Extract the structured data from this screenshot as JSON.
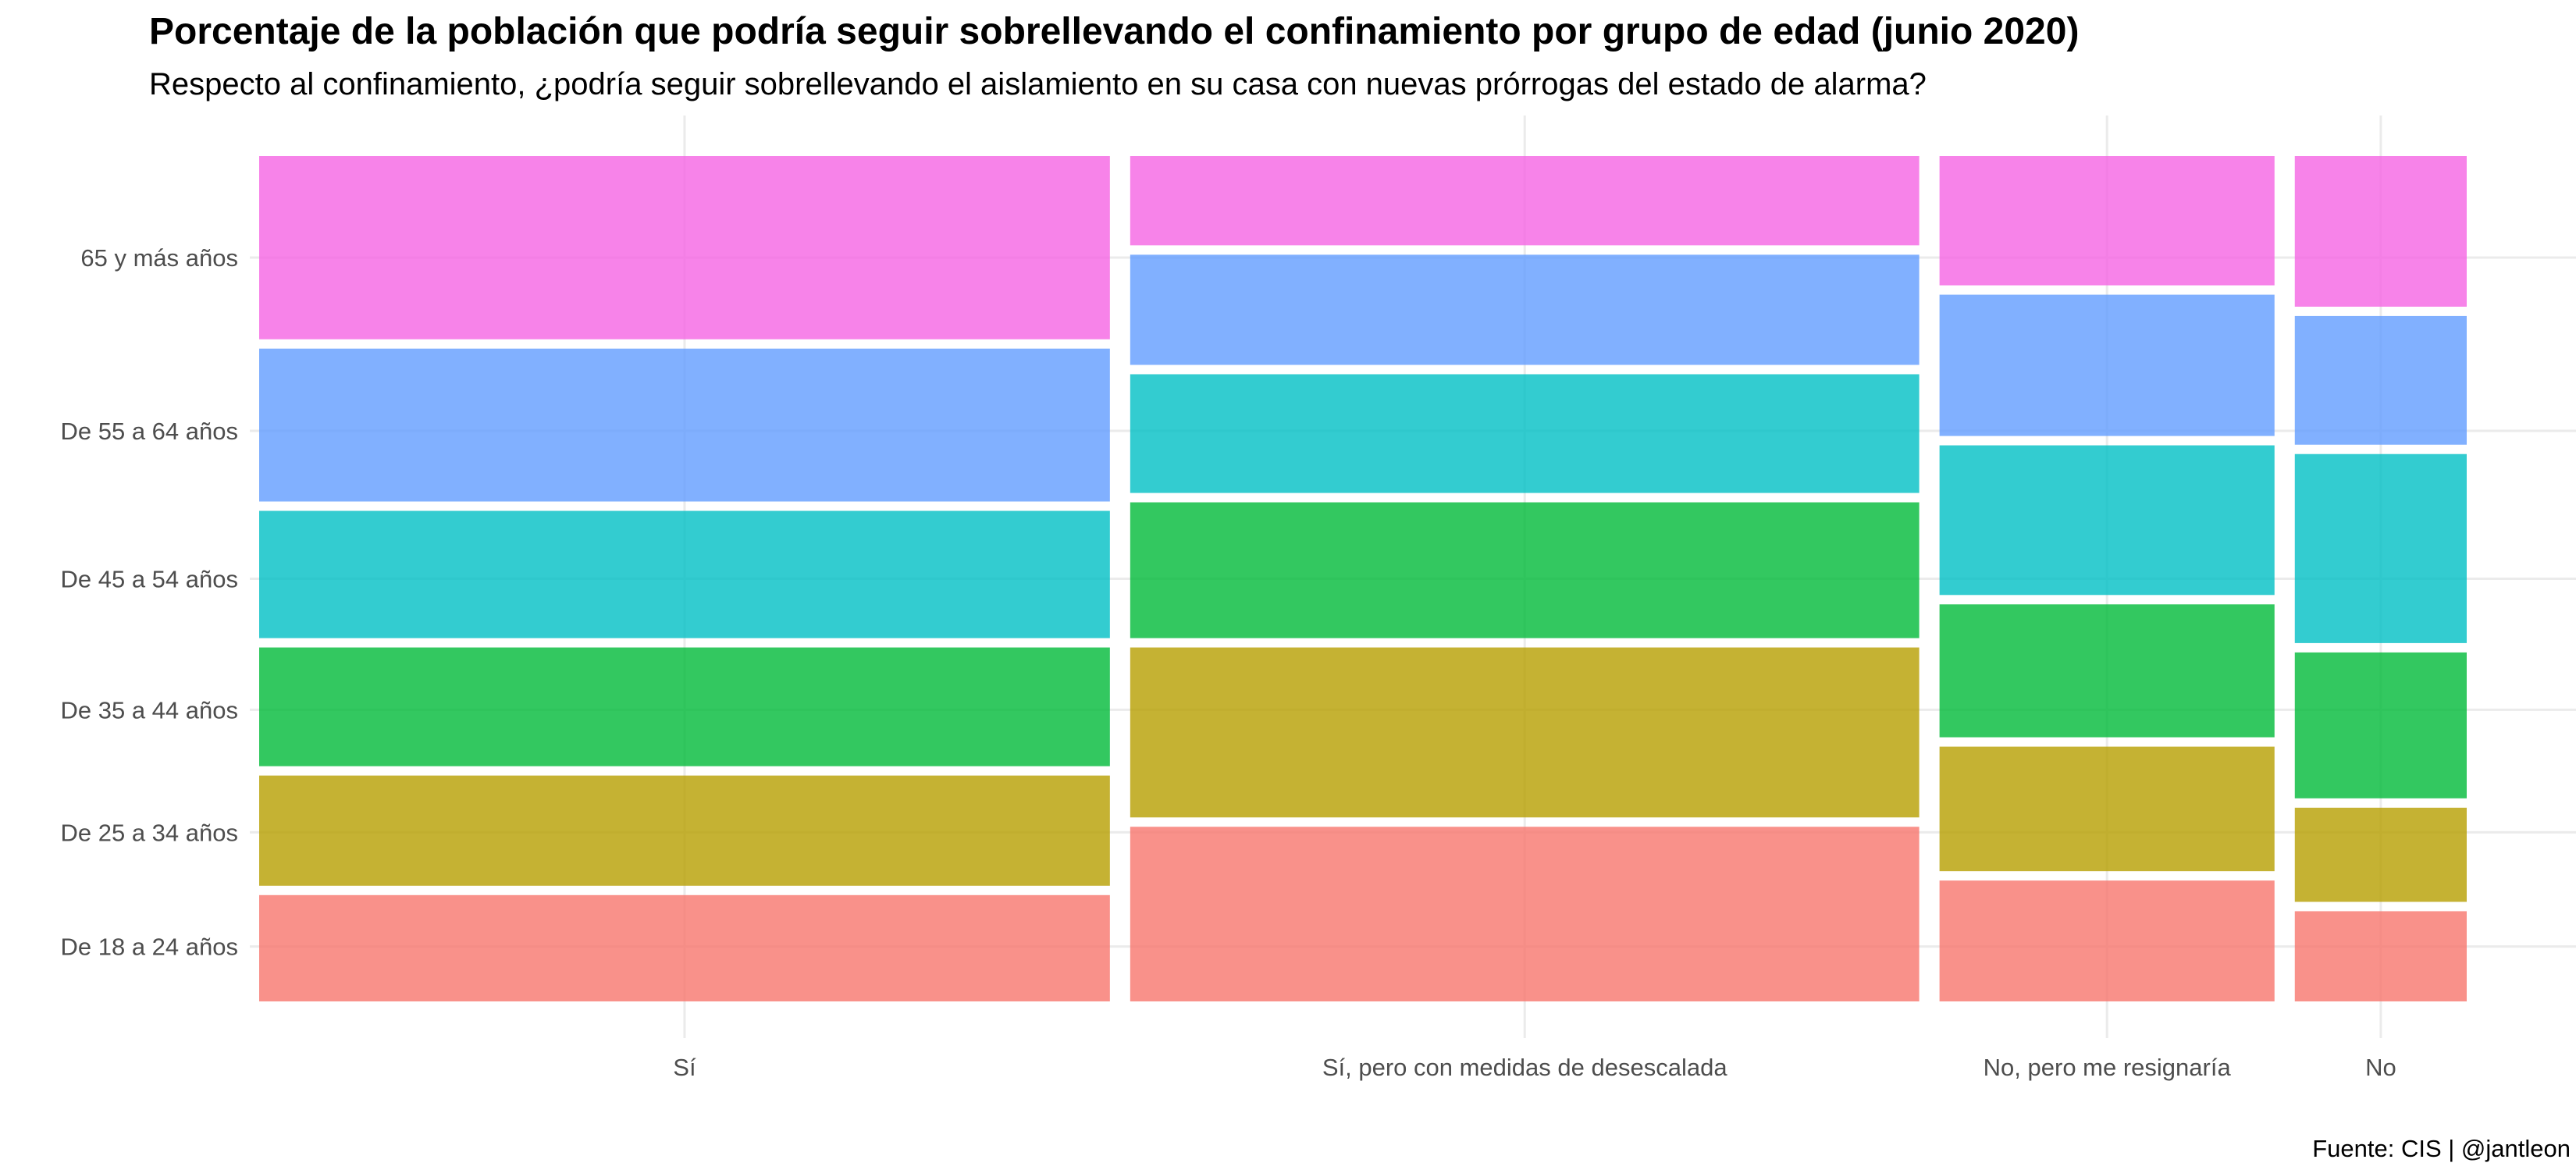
{
  "chart_data": {
    "type": "mosaic",
    "title": "Porcentaje de la población que podría seguir sobrellevando el confinamiento por grupo de edad (junio 2020)",
    "subtitle": "Respecto al confinamiento, ¿podría seguir sobrellevando el aislamiento en su casa con nuevas prórrogas del estado de alarma?",
    "caption": "Fuente: CIS | @jantleon",
    "categories": [
      "Sí",
      "Sí, pero con medidas de desescalada",
      "No, pero me resignaría",
      "No"
    ],
    "category_widths": [
      0.386,
      0.358,
      0.152,
      0.078
    ],
    "age_groups": [
      "De 18 a 24 años",
      "De 25 a 34 años",
      "De 35 a 44 años",
      "De 45 a 54 años",
      "De 55 a 64 años",
      "65 y más años"
    ],
    "colors": [
      "#F8766D",
      "#B79F00",
      "#00BA38",
      "#00BFC4",
      "#619CFF",
      "#F564E3"
    ],
    "fill_opacity": 0.8,
    "proportions": [
      [
        0.13,
        0.14,
        0.15,
        0.16,
        0.19,
        0.22
      ],
      [
        0.21,
        0.21,
        0.17,
        0.15,
        0.14,
        0.11
      ],
      [
        0.15,
        0.16,
        0.17,
        0.19,
        0.18,
        0.16
      ],
      [
        0.11,
        0.12,
        0.18,
        0.23,
        0.16,
        0.18
      ]
    ],
    "grid": true,
    "legend": "none"
  }
}
